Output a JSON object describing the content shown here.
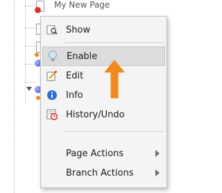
{
  "tree": {
    "top_row_text": "My New Page"
  },
  "menu": {
    "items": [
      {
        "label": "Show",
        "icon": "show-icon"
      },
      {
        "label": "Enable",
        "icon": "lightbulb-icon"
      },
      {
        "label": "Edit",
        "icon": "edit-icon"
      },
      {
        "label": "Info",
        "icon": "info-icon"
      },
      {
        "label": "History/Undo",
        "icon": "history-icon"
      },
      {
        "label": "Page Actions",
        "submenu": true
      },
      {
        "label": "Branch Actions",
        "submenu": true
      }
    ],
    "highlighted_item": "Enable"
  },
  "annotation": {
    "arrow_color": "#f08a1e"
  }
}
